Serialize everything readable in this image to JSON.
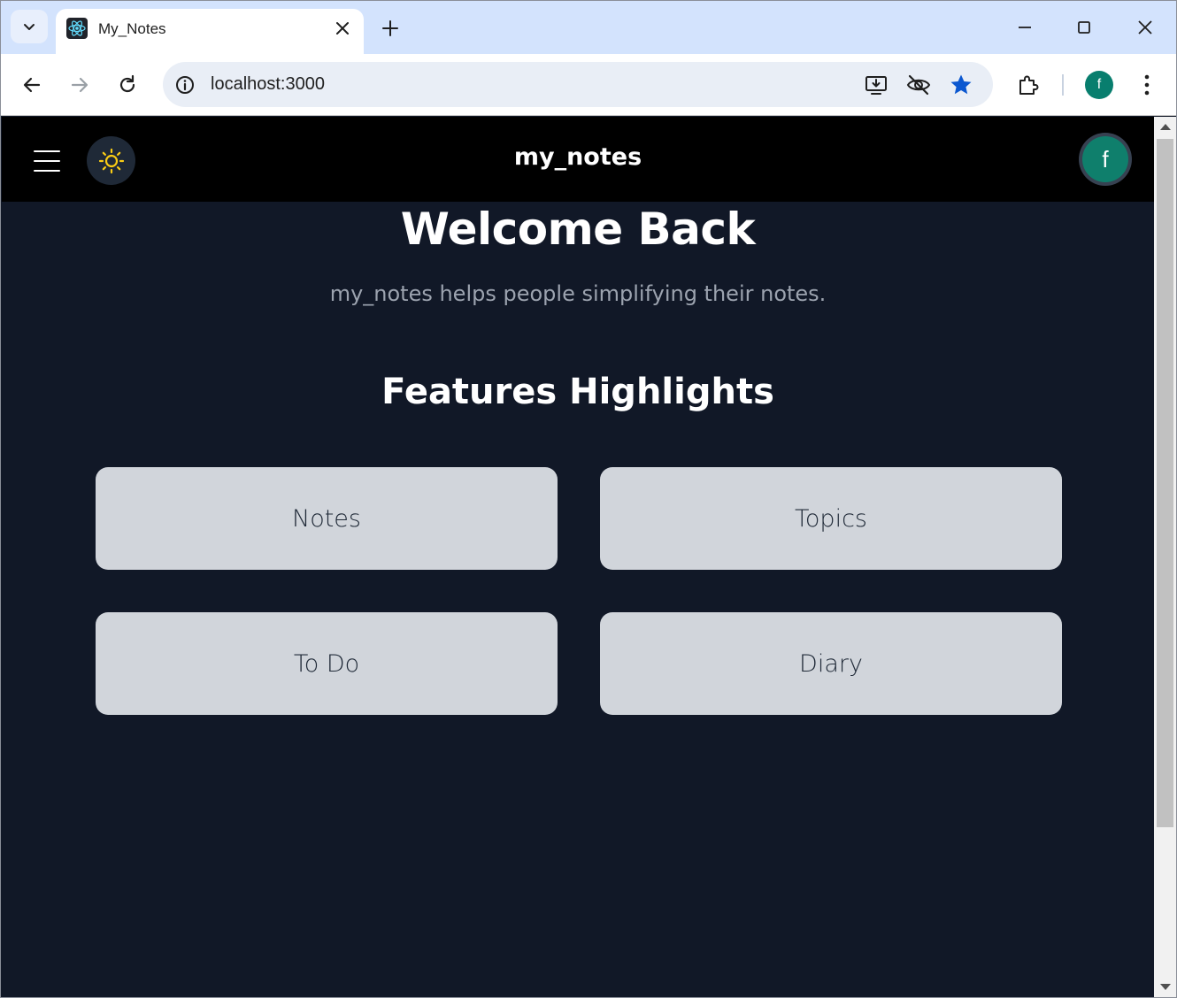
{
  "browser": {
    "tab": {
      "title": "My_Notes",
      "favicon": "react-logo-icon"
    },
    "address": {
      "url": "localhost:3000"
    },
    "profile_initial": "f"
  },
  "app": {
    "brand": "my_notes",
    "user_initial": "f",
    "theme_icon": "sun-icon",
    "accent": "#0f7f6c",
    "background": "#111827"
  },
  "hero": {
    "title": "Welcome Back",
    "subtitle": "my_notes helps people simplifying their notes."
  },
  "features": {
    "title": "Features Highlights",
    "items": [
      {
        "label": "Notes"
      },
      {
        "label": "Topics"
      },
      {
        "label": "To Do"
      },
      {
        "label": "Diary"
      }
    ]
  }
}
